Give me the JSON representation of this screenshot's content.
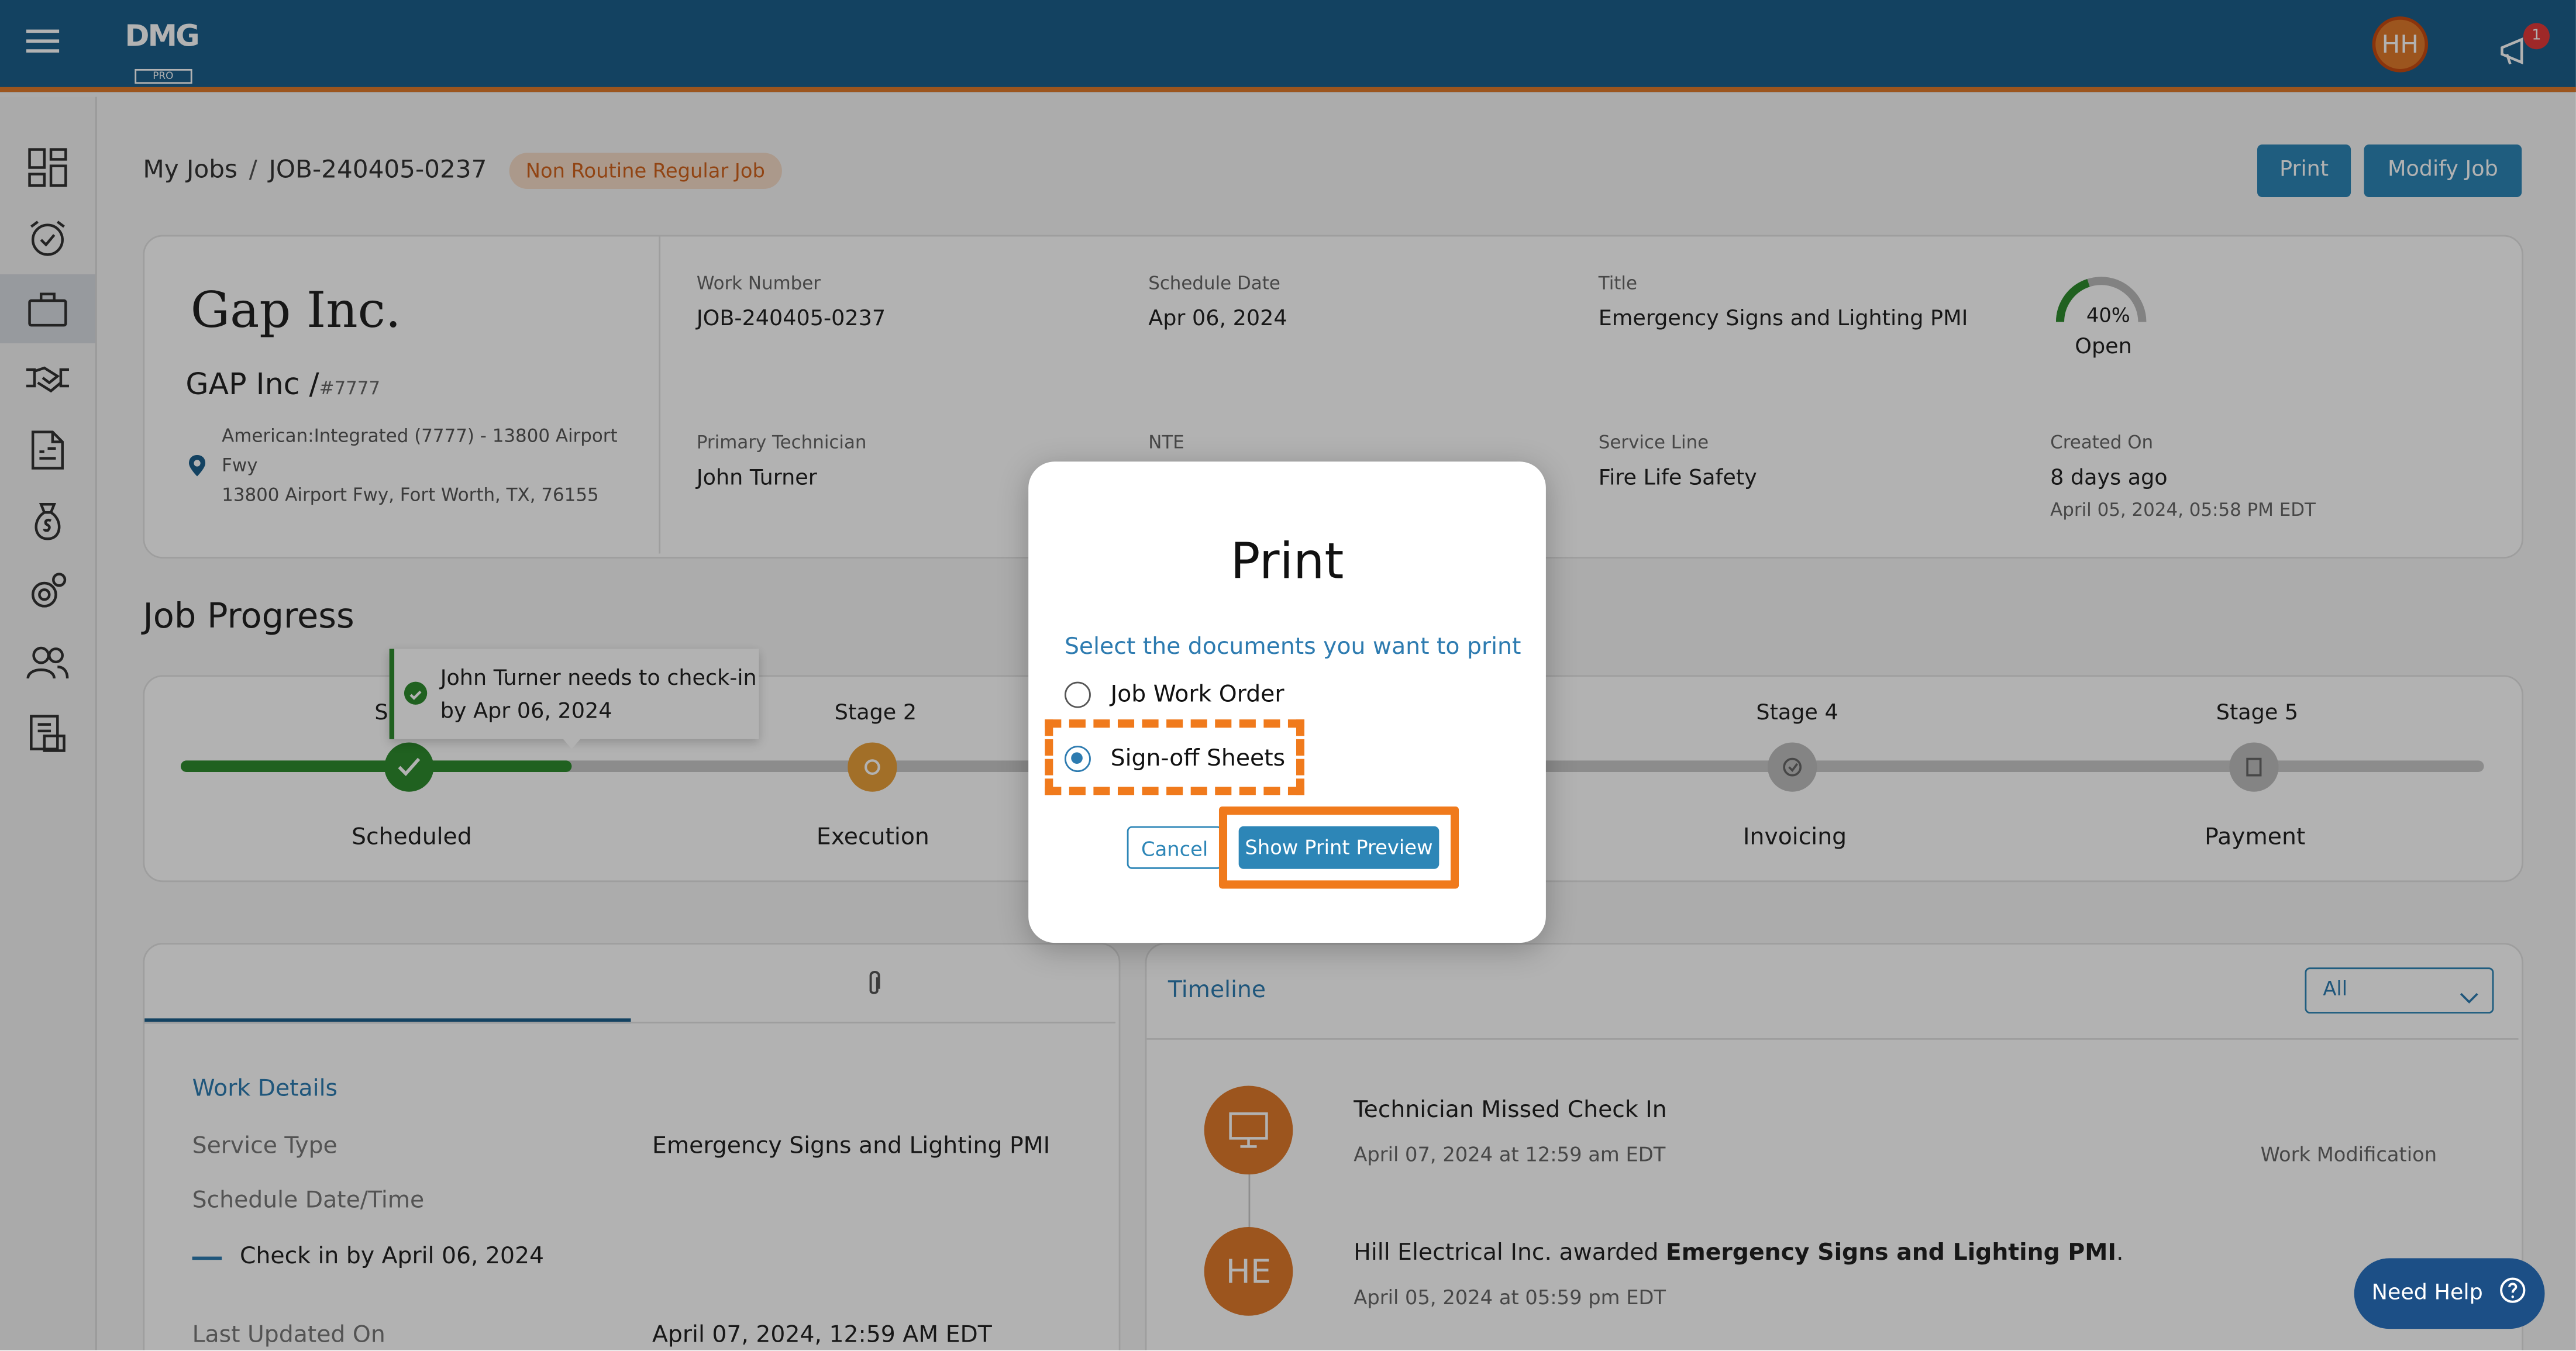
{
  "header": {
    "logo_text": "DMG",
    "logo_sub": "PRO",
    "avatar_initials": "HH",
    "notification_count": "1"
  },
  "sidebar": {
    "items": [
      {
        "icon": "dashboard-icon"
      },
      {
        "icon": "alarm-check-icon"
      },
      {
        "icon": "briefcase-icon",
        "active": true
      },
      {
        "icon": "handshake-icon"
      },
      {
        "icon": "invoice-icon"
      },
      {
        "icon": "money-bag-icon"
      },
      {
        "icon": "settings-icon"
      },
      {
        "icon": "users-icon"
      },
      {
        "icon": "report-icon"
      }
    ]
  },
  "breadcrumb": {
    "root": "My Jobs",
    "separator": "/",
    "current": "JOB-240405-0237",
    "tag": "Non Routine Regular Job"
  },
  "actions": {
    "print": "Print",
    "modify": "Modify Job"
  },
  "customer": {
    "logo_text": "Gap Inc.",
    "name": "GAP Inc /",
    "number": "#7777",
    "address_line1": "American:Integrated (7777) - 13800 Airport",
    "address_line2": "Fwy",
    "address_line3": "13800 Airport Fwy, Fort Worth, TX, 76155"
  },
  "job": {
    "work_number_label": "Work Number",
    "work_number": "JOB-240405-0237",
    "schedule_date_label": "Schedule Date",
    "schedule_date": "Apr 06, 2024",
    "title_label": "Title",
    "title": "Emergency Signs and Lighting PMI",
    "progress_pct": "40%",
    "progress_value": 0.4,
    "status": "Open",
    "primary_tech_label": "Primary Technician",
    "primary_tech": "John Turner",
    "nte_label": "NTE",
    "service_line_label": "Service Line",
    "service_line": "Fire Life Safety",
    "created_label": "Created On",
    "created_relative": "8 days ago",
    "created_date": "April 05, 2024, 05:58 PM EDT"
  },
  "progress": {
    "heading": "Job Progress",
    "tooltip_line1": "John Turner needs to check-in",
    "tooltip_line2": "by Apr 06, 2024",
    "stage1_label_fragment": "S",
    "stages": [
      {
        "stage": "Stage 2",
        "name": "Execution"
      },
      {
        "stage": "Stage 4",
        "name": "Invoicing"
      },
      {
        "stage": "Stage 5",
        "name": "Payment"
      }
    ],
    "stage1_name": "Scheduled"
  },
  "details": {
    "section": "Work Details",
    "service_type_label": "Service Type",
    "service_type": "Emergency Signs and Lighting PMI",
    "schedule_label": "Schedule Date/Time",
    "check_in": "Check in by April 06, 2024",
    "updated_label": "Last Updated On",
    "updated": "April 07, 2024, 12:59 AM EDT"
  },
  "timeline": {
    "title": "Timeline",
    "filter": "All",
    "events": [
      {
        "title": "Technician Missed Check In",
        "date": "April 07, 2024 at 12:59 am EDT",
        "tag": "Work Modification"
      },
      {
        "initials": "HE",
        "title_prefix": "Hill Electrical Inc. awarded ",
        "title_bold": "Emergency Signs and Lighting PMI",
        "title_suffix": ".",
        "date": "April 05, 2024 at 05:59 pm EDT"
      }
    ]
  },
  "modal": {
    "title": "Print",
    "subtitle": "Select the documents you want to print",
    "option1": "Job Work Order",
    "option2": "Sign-off Sheets",
    "selected": "Sign-off Sheets",
    "cancel": "Cancel",
    "preview": "Show Print Preview"
  },
  "help": {
    "label": "Need Help"
  },
  "colors": {
    "brand_blue": "#1c5f8c",
    "accent_orange": "#e07a2c",
    "button_blue": "#2d86b7",
    "success_green": "#2e8b2e",
    "highlight_orange": "#f07a1c"
  }
}
